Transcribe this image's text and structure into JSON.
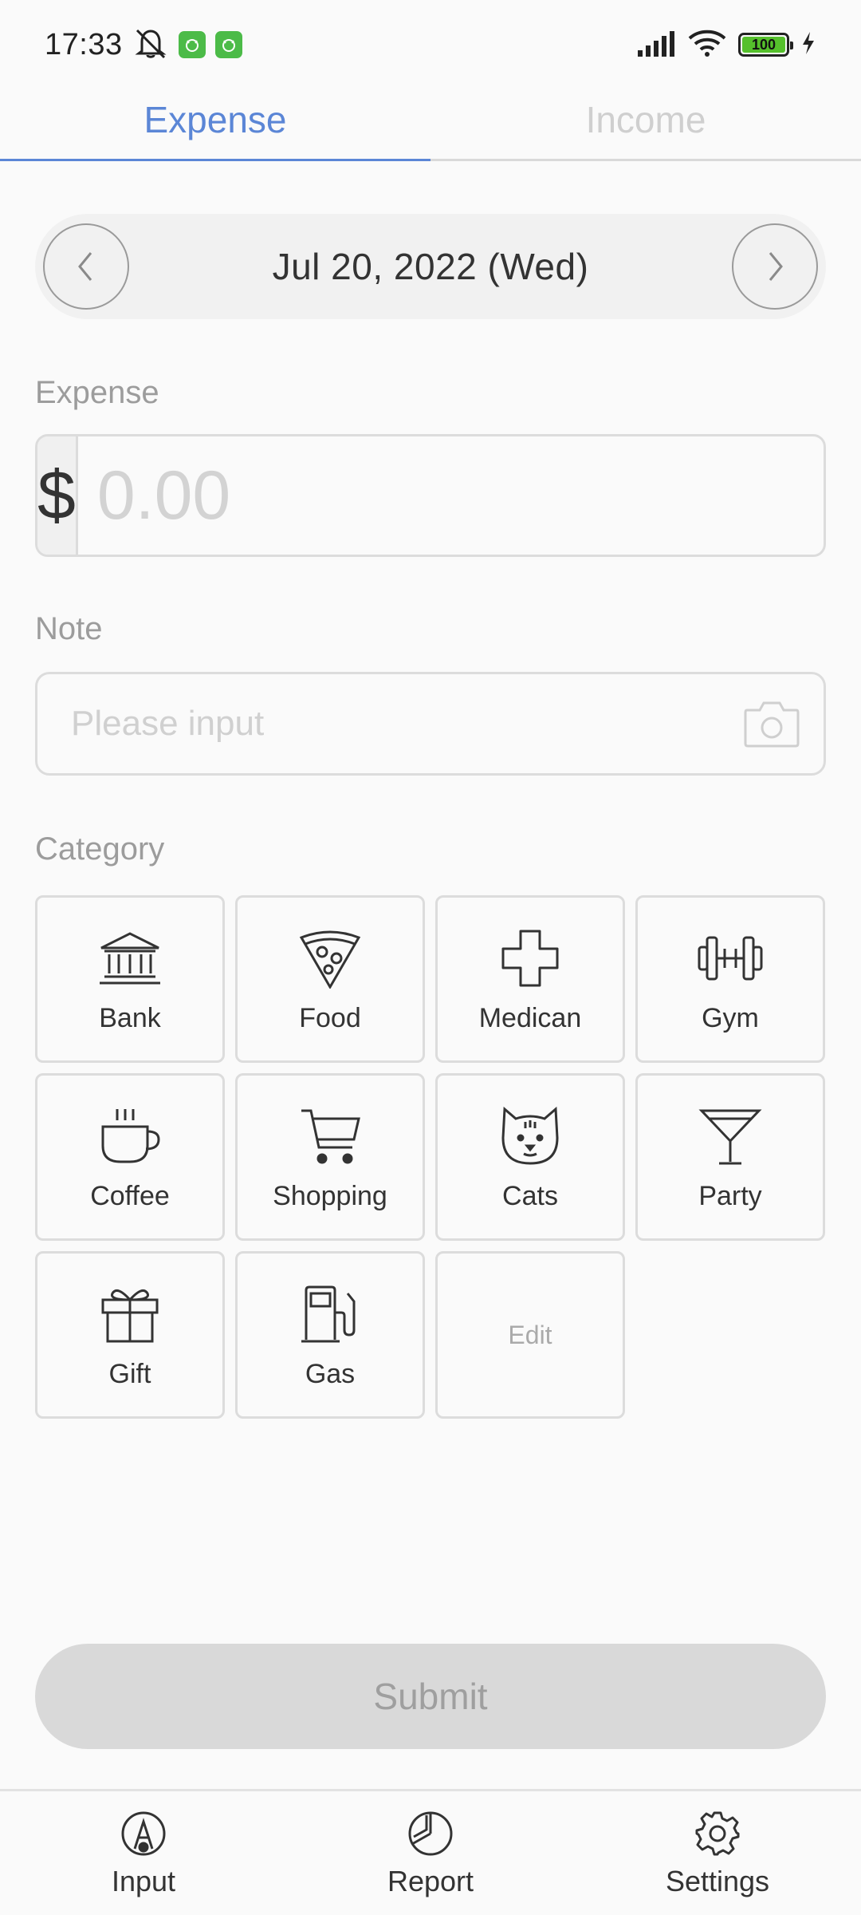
{
  "status_bar": {
    "time": "17:33",
    "battery": "100",
    "icons": [
      "mute-bell-icon",
      "app-badge-icon",
      "app-badge-icon",
      "signal-icon",
      "wifi-icon",
      "battery-icon",
      "charging-icon"
    ]
  },
  "tabs": [
    {
      "label": "Expense",
      "active": true
    },
    {
      "label": "Income",
      "active": false
    }
  ],
  "date_bar": {
    "date": "Jul 20, 2022 (Wed)"
  },
  "expense": {
    "label": "Expense",
    "currency": "$",
    "placeholder": "0.00"
  },
  "note": {
    "label": "Note",
    "placeholder": "Please input"
  },
  "category": {
    "label": "Category",
    "items": [
      {
        "label": "Bank",
        "icon": "bank-icon"
      },
      {
        "label": "Food",
        "icon": "pizza-icon"
      },
      {
        "label": "Medican",
        "icon": "medical-cross-icon"
      },
      {
        "label": "Gym",
        "icon": "dumbbell-icon"
      },
      {
        "label": "Coffee",
        "icon": "coffee-cup-icon"
      },
      {
        "label": "Shopping",
        "icon": "shopping-cart-icon"
      },
      {
        "label": "Cats",
        "icon": "cat-icon"
      },
      {
        "label": "Party",
        "icon": "cocktail-icon"
      },
      {
        "label": "Gift",
        "icon": "gift-icon"
      },
      {
        "label": "Gas",
        "icon": "gas-pump-icon"
      }
    ],
    "edit_label": "Edit"
  },
  "submit_label": "Submit",
  "bottom_nav": [
    {
      "label": "Input",
      "icon": "pencil-circle-icon"
    },
    {
      "label": "Report",
      "icon": "pie-chart-icon"
    },
    {
      "label": "Settings",
      "icon": "gear-icon"
    }
  ],
  "colors": {
    "accent": "#5b86d6",
    "background": "#fafafa",
    "border": "#dcdcdc",
    "submit_disabled": "#d9d9d9"
  }
}
